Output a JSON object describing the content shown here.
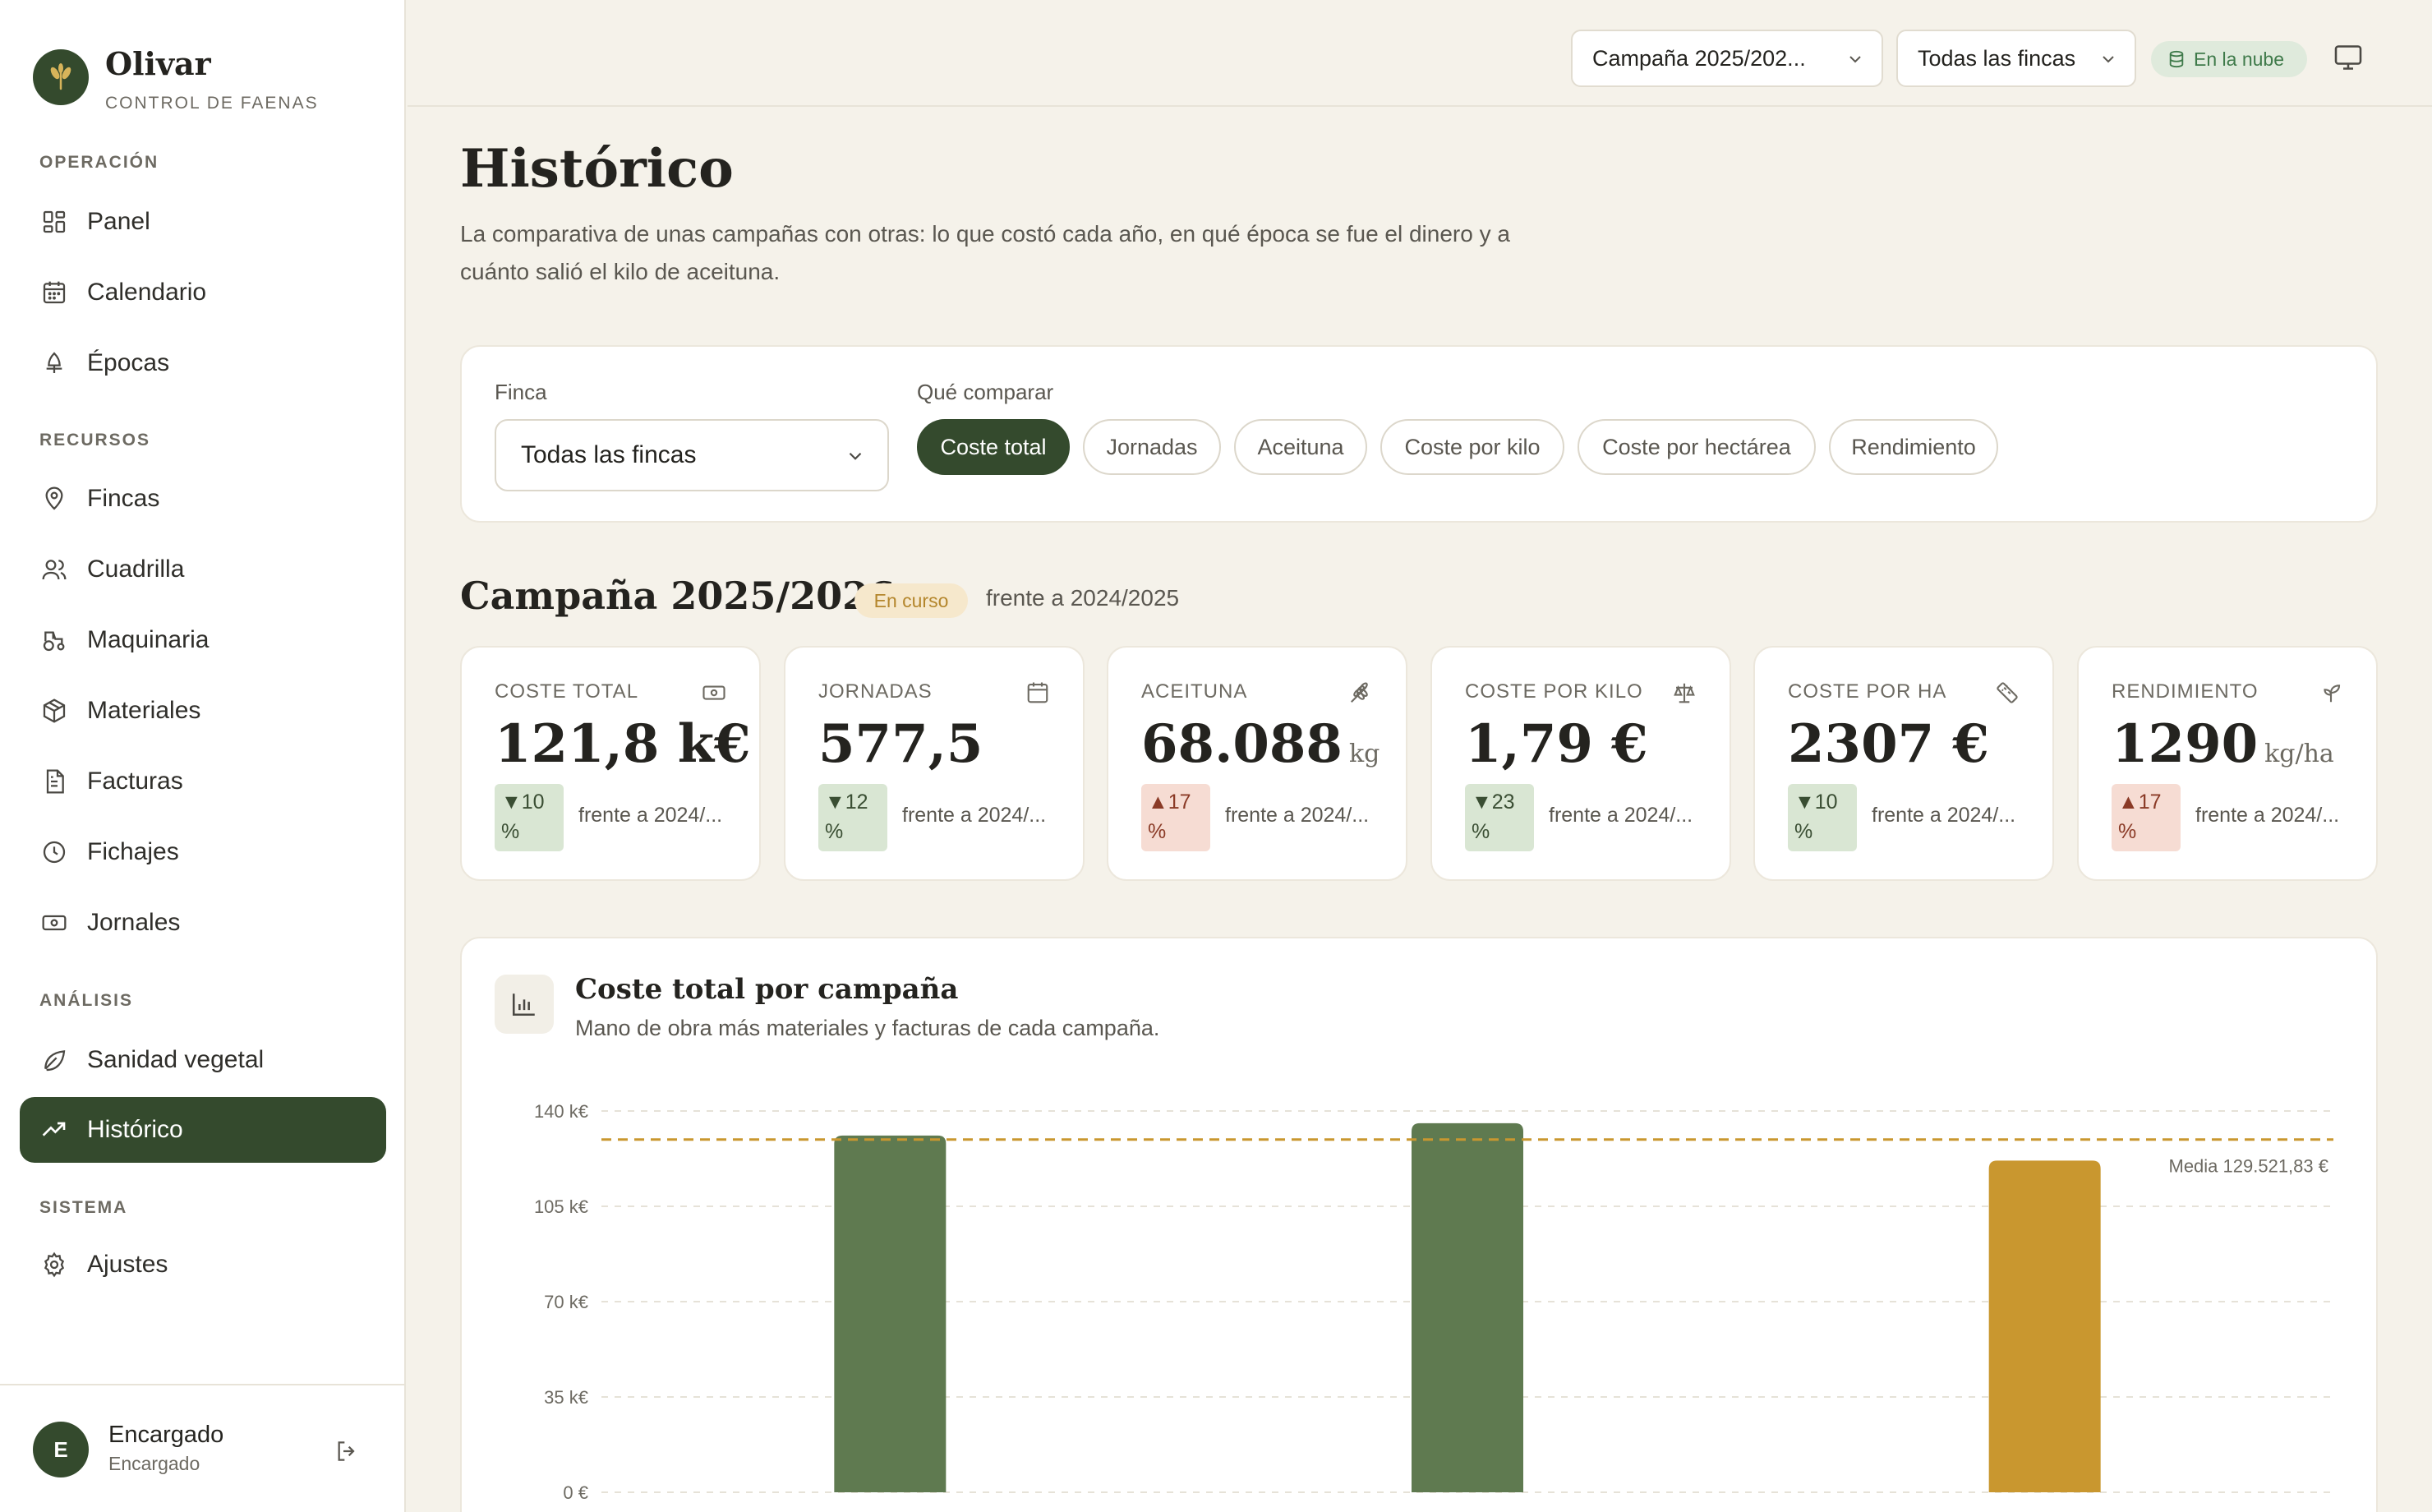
{
  "brand": {
    "name": "Olivar",
    "subtitle": "CONTROL DE FAENAS"
  },
  "nav": {
    "operacion_label": "OPERACIÓN",
    "recursos_label": "RECURSOS",
    "analisis_label": "ANÁLISIS",
    "sistema_label": "SISTEMA",
    "items": [
      {
        "id": "panel",
        "label": "Panel",
        "icon": "grid-icon"
      },
      {
        "id": "calendario",
        "label": "Calendario",
        "icon": "calendar-icon"
      },
      {
        "id": "epocas",
        "label": "Épocas",
        "icon": "tree-icon"
      },
      {
        "id": "fincas",
        "label": "Fincas",
        "icon": "map-pin-icon"
      },
      {
        "id": "cuadrilla",
        "label": "Cuadrilla",
        "icon": "users-icon"
      },
      {
        "id": "maquinaria",
        "label": "Maquinaria",
        "icon": "tractor-icon"
      },
      {
        "id": "materiales",
        "label": "Materiales",
        "icon": "box-icon"
      },
      {
        "id": "facturas",
        "label": "Facturas",
        "icon": "document-icon"
      },
      {
        "id": "fichajes",
        "label": "Fichajes",
        "icon": "clock-icon"
      },
      {
        "id": "jornales",
        "label": "Jornales",
        "icon": "banknote-icon"
      },
      {
        "id": "sanidad",
        "label": "Sanidad vegetal",
        "icon": "leaf-icon"
      },
      {
        "id": "historico",
        "label": "Histórico",
        "icon": "trending-up-icon",
        "active": true
      },
      {
        "id": "ajustes",
        "label": "Ajustes",
        "icon": "gear-icon"
      }
    ]
  },
  "user": {
    "initial": "E",
    "name": "Encargado",
    "role": "Encargado"
  },
  "topbar": {
    "campaign_select": "Campaña 2025/202...",
    "finca_select": "Todas las fincas",
    "cloud_badge": "En la nube"
  },
  "page": {
    "title": "Histórico",
    "description": "La comparativa de unas campañas con otras: lo que costó cada año, en qué época se fue el dinero y a cuánto salió el kilo de aceituna."
  },
  "filters": {
    "finca_label": "Finca",
    "finca_value": "Todas las fincas",
    "compare_label": "Qué comparar",
    "options": [
      "Coste total",
      "Jornadas",
      "Aceituna",
      "Coste por kilo",
      "Coste por hectárea",
      "Rendimiento"
    ],
    "selected": "Coste total"
  },
  "campaign": {
    "title": "Campaña 2025/2026",
    "badge": "En curso",
    "vs": "frente a 2024/2025"
  },
  "kpis": [
    {
      "label": "COSTE TOTAL",
      "value": "121,8 k€",
      "unit": "",
      "delta_dir": "down",
      "delta_arrow": "▼",
      "delta_num": "10",
      "delta_pct": "%",
      "vs": "frente a 2024/...",
      "icon": "banknote-icon"
    },
    {
      "label": "JORNADAS",
      "value": "577,5",
      "unit": "",
      "delta_dir": "down",
      "delta_arrow": "▼",
      "delta_num": "12",
      "delta_pct": "%",
      "vs": "frente a 2024/...",
      "icon": "calendar-icon"
    },
    {
      "label": "ACEITUNA",
      "value": "68.088",
      "unit": "kg",
      "delta_dir": "up",
      "delta_arrow": "▲",
      "delta_num": "17",
      "delta_pct": "%",
      "vs": "frente a 2024/...",
      "icon": "wheat-icon"
    },
    {
      "label": "COSTE POR KILO",
      "value": "1,79 €",
      "unit": "",
      "delta_dir": "down",
      "delta_arrow": "▼",
      "delta_num": "23",
      "delta_pct": "%",
      "vs": "frente a 2024/...",
      "icon": "scale-icon"
    },
    {
      "label": "COSTE POR HA",
      "value": "2307 €",
      "unit": "",
      "delta_dir": "down",
      "delta_arrow": "▼",
      "delta_num": "10",
      "delta_pct": "%",
      "vs": "frente a 2024/...",
      "icon": "ruler-icon"
    },
    {
      "label": "RENDIMIENTO",
      "value": "1290",
      "unit": "kg/ha",
      "delta_dir": "up",
      "delta_arrow": "▲",
      "delta_num": "17",
      "delta_pct": "%",
      "vs": "frente a 2024/...",
      "icon": "sprout-icon"
    }
  ],
  "chart_card": {
    "title": "Coste total por campaña",
    "subtitle": "Mano de obra más materiales y facturas de cada campaña."
  },
  "chart_data": {
    "type": "bar",
    "values": [
      131000,
      135500,
      121800
    ],
    "bar_colors": [
      "#5f7a50",
      "#5f7a50",
      "#c9972f"
    ],
    "ylim": [
      0,
      140000
    ],
    "yticks": [
      "0 €",
      "35 k€",
      "70 k€",
      "105 k€",
      "140 k€"
    ],
    "mean_value": 129521.83,
    "mean_label": "Media 129.521,83 €",
    "mean_color": "#c9972f",
    "grid": true
  },
  "colors": {
    "accent": "#344a2d",
    "background": "#f5f2ea",
    "gold": "#c9972f"
  }
}
